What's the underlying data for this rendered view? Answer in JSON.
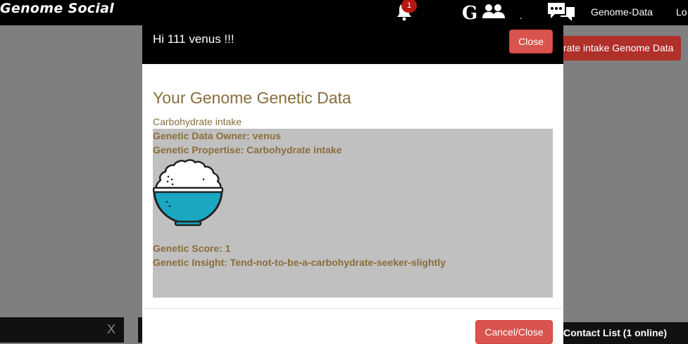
{
  "navbar": {
    "brand": "Genome Social",
    "notification_count": "1",
    "g_logo": "G",
    "links": [
      "Genome-Data",
      "Lo"
    ]
  },
  "background": {
    "genome_button_label": "rate intake Genome Data",
    "chat_close": "X",
    "contact_list": "Contact List (1 online)"
  },
  "modal": {
    "title": "Hi 111 venus !!!",
    "close_label": "Close",
    "section_title": "Your Genome Genetic Data",
    "subtitle": "Carbohydrate intake",
    "owner": "Genetic Data Owner: venus",
    "propertise": "Genetic Propertise: Carbohydrate intake",
    "image_icon": "rice-bowl-icon",
    "score": "Genetic Score: 1",
    "insight": "Genetic Insight: Tend-not-to-be-a-carbohydrate-seeker-slightly",
    "cancel_label": "Cancel/Close"
  },
  "colors": {
    "danger": "#d9534f",
    "text_brown": "#8a6d3b",
    "panel_gray": "#c0c0c0",
    "bowl_teal": "#1aa7c2"
  }
}
